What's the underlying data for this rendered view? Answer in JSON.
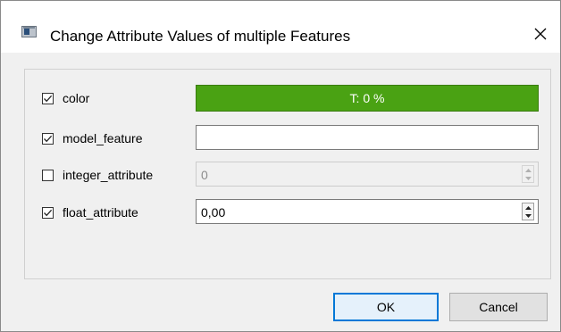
{
  "window": {
    "title": "Change Attribute Values of multiple Features",
    "close_glyph": "✕"
  },
  "fields": [
    {
      "name": "color",
      "checked": true,
      "widget": "color-button",
      "value": "T: 0 %",
      "color": "#4aa213"
    },
    {
      "name": "model_feature",
      "checked": true,
      "widget": "text-input",
      "value": ""
    },
    {
      "name": "integer_attribute",
      "checked": false,
      "widget": "spinbox",
      "value": "0",
      "enabled": false
    },
    {
      "name": "float_attribute",
      "checked": true,
      "widget": "spinbox",
      "value": "0,00",
      "enabled": true
    }
  ],
  "buttons": {
    "ok": "OK",
    "cancel": "Cancel"
  },
  "icons": {
    "app": "window-icon",
    "close": "close-icon",
    "check": "checkmark-icon",
    "spin_up": "triangle-up-icon",
    "spin_down": "triangle-down-icon"
  },
  "colors": {
    "accent": "#0078d7",
    "color_button": "#4aa213"
  }
}
